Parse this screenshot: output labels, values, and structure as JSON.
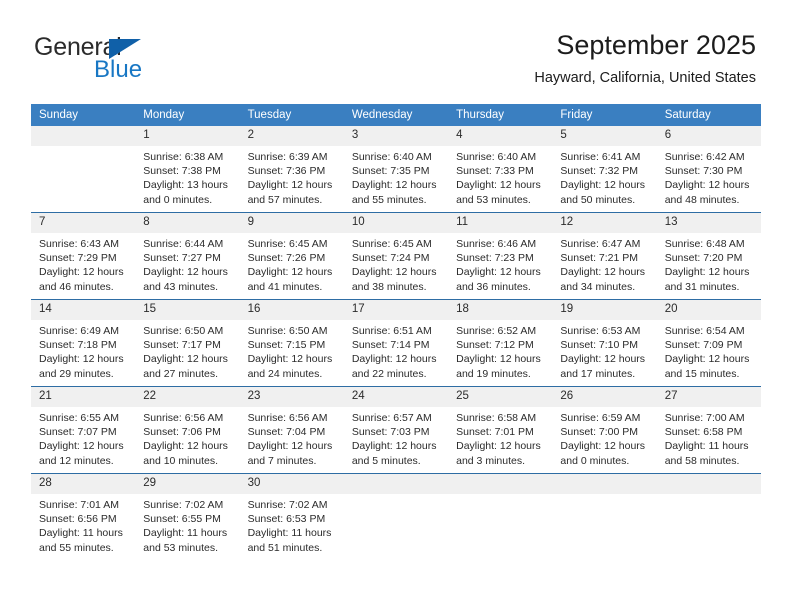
{
  "logo": {
    "word1": "General",
    "word2": "Blue",
    "triangle_color": "#1060a8",
    "blue_color": "#1877c4"
  },
  "header": {
    "title": "September 2025",
    "subtitle": "Hayward, California, United States",
    "header_bg": "#3a7fc1",
    "row_divider_color": "#2e6da4",
    "daynum_band_color": "#f0f0f0"
  },
  "weekday_headers": [
    "Sunday",
    "Monday",
    "Tuesday",
    "Wednesday",
    "Thursday",
    "Friday",
    "Saturday"
  ],
  "weeks": [
    [
      {
        "day": "",
        "sunrise": "",
        "sunset": "",
        "daylight1": "",
        "daylight2": ""
      },
      {
        "day": "1",
        "sunrise": "Sunrise: 6:38 AM",
        "sunset": "Sunset: 7:38 PM",
        "daylight1": "Daylight: 13 hours",
        "daylight2": "and 0 minutes."
      },
      {
        "day": "2",
        "sunrise": "Sunrise: 6:39 AM",
        "sunset": "Sunset: 7:36 PM",
        "daylight1": "Daylight: 12 hours",
        "daylight2": "and 57 minutes."
      },
      {
        "day": "3",
        "sunrise": "Sunrise: 6:40 AM",
        "sunset": "Sunset: 7:35 PM",
        "daylight1": "Daylight: 12 hours",
        "daylight2": "and 55 minutes."
      },
      {
        "day": "4",
        "sunrise": "Sunrise: 6:40 AM",
        "sunset": "Sunset: 7:33 PM",
        "daylight1": "Daylight: 12 hours",
        "daylight2": "and 53 minutes."
      },
      {
        "day": "5",
        "sunrise": "Sunrise: 6:41 AM",
        "sunset": "Sunset: 7:32 PM",
        "daylight1": "Daylight: 12 hours",
        "daylight2": "and 50 minutes."
      },
      {
        "day": "6",
        "sunrise": "Sunrise: 6:42 AM",
        "sunset": "Sunset: 7:30 PM",
        "daylight1": "Daylight: 12 hours",
        "daylight2": "and 48 minutes."
      }
    ],
    [
      {
        "day": "7",
        "sunrise": "Sunrise: 6:43 AM",
        "sunset": "Sunset: 7:29 PM",
        "daylight1": "Daylight: 12 hours",
        "daylight2": "and 46 minutes."
      },
      {
        "day": "8",
        "sunrise": "Sunrise: 6:44 AM",
        "sunset": "Sunset: 7:27 PM",
        "daylight1": "Daylight: 12 hours",
        "daylight2": "and 43 minutes."
      },
      {
        "day": "9",
        "sunrise": "Sunrise: 6:45 AM",
        "sunset": "Sunset: 7:26 PM",
        "daylight1": "Daylight: 12 hours",
        "daylight2": "and 41 minutes."
      },
      {
        "day": "10",
        "sunrise": "Sunrise: 6:45 AM",
        "sunset": "Sunset: 7:24 PM",
        "daylight1": "Daylight: 12 hours",
        "daylight2": "and 38 minutes."
      },
      {
        "day": "11",
        "sunrise": "Sunrise: 6:46 AM",
        "sunset": "Sunset: 7:23 PM",
        "daylight1": "Daylight: 12 hours",
        "daylight2": "and 36 minutes."
      },
      {
        "day": "12",
        "sunrise": "Sunrise: 6:47 AM",
        "sunset": "Sunset: 7:21 PM",
        "daylight1": "Daylight: 12 hours",
        "daylight2": "and 34 minutes."
      },
      {
        "day": "13",
        "sunrise": "Sunrise: 6:48 AM",
        "sunset": "Sunset: 7:20 PM",
        "daylight1": "Daylight: 12 hours",
        "daylight2": "and 31 minutes."
      }
    ],
    [
      {
        "day": "14",
        "sunrise": "Sunrise: 6:49 AM",
        "sunset": "Sunset: 7:18 PM",
        "daylight1": "Daylight: 12 hours",
        "daylight2": "and 29 minutes."
      },
      {
        "day": "15",
        "sunrise": "Sunrise: 6:50 AM",
        "sunset": "Sunset: 7:17 PM",
        "daylight1": "Daylight: 12 hours",
        "daylight2": "and 27 minutes."
      },
      {
        "day": "16",
        "sunrise": "Sunrise: 6:50 AM",
        "sunset": "Sunset: 7:15 PM",
        "daylight1": "Daylight: 12 hours",
        "daylight2": "and 24 minutes."
      },
      {
        "day": "17",
        "sunrise": "Sunrise: 6:51 AM",
        "sunset": "Sunset: 7:14 PM",
        "daylight1": "Daylight: 12 hours",
        "daylight2": "and 22 minutes."
      },
      {
        "day": "18",
        "sunrise": "Sunrise: 6:52 AM",
        "sunset": "Sunset: 7:12 PM",
        "daylight1": "Daylight: 12 hours",
        "daylight2": "and 19 minutes."
      },
      {
        "day": "19",
        "sunrise": "Sunrise: 6:53 AM",
        "sunset": "Sunset: 7:10 PM",
        "daylight1": "Daylight: 12 hours",
        "daylight2": "and 17 minutes."
      },
      {
        "day": "20",
        "sunrise": "Sunrise: 6:54 AM",
        "sunset": "Sunset: 7:09 PM",
        "daylight1": "Daylight: 12 hours",
        "daylight2": "and 15 minutes."
      }
    ],
    [
      {
        "day": "21",
        "sunrise": "Sunrise: 6:55 AM",
        "sunset": "Sunset: 7:07 PM",
        "daylight1": "Daylight: 12 hours",
        "daylight2": "and 12 minutes."
      },
      {
        "day": "22",
        "sunrise": "Sunrise: 6:56 AM",
        "sunset": "Sunset: 7:06 PM",
        "daylight1": "Daylight: 12 hours",
        "daylight2": "and 10 minutes."
      },
      {
        "day": "23",
        "sunrise": "Sunrise: 6:56 AM",
        "sunset": "Sunset: 7:04 PM",
        "daylight1": "Daylight: 12 hours",
        "daylight2": "and 7 minutes."
      },
      {
        "day": "24",
        "sunrise": "Sunrise: 6:57 AM",
        "sunset": "Sunset: 7:03 PM",
        "daylight1": "Daylight: 12 hours",
        "daylight2": "and 5 minutes."
      },
      {
        "day": "25",
        "sunrise": "Sunrise: 6:58 AM",
        "sunset": "Sunset: 7:01 PM",
        "daylight1": "Daylight: 12 hours",
        "daylight2": "and 3 minutes."
      },
      {
        "day": "26",
        "sunrise": "Sunrise: 6:59 AM",
        "sunset": "Sunset: 7:00 PM",
        "daylight1": "Daylight: 12 hours",
        "daylight2": "and 0 minutes."
      },
      {
        "day": "27",
        "sunrise": "Sunrise: 7:00 AM",
        "sunset": "Sunset: 6:58 PM",
        "daylight1": "Daylight: 11 hours",
        "daylight2": "and 58 minutes."
      }
    ],
    [
      {
        "day": "28",
        "sunrise": "Sunrise: 7:01 AM",
        "sunset": "Sunset: 6:56 PM",
        "daylight1": "Daylight: 11 hours",
        "daylight2": "and 55 minutes."
      },
      {
        "day": "29",
        "sunrise": "Sunrise: 7:02 AM",
        "sunset": "Sunset: 6:55 PM",
        "daylight1": "Daylight: 11 hours",
        "daylight2": "and 53 minutes."
      },
      {
        "day": "30",
        "sunrise": "Sunrise: 7:02 AM",
        "sunset": "Sunset: 6:53 PM",
        "daylight1": "Daylight: 11 hours",
        "daylight2": "and 51 minutes."
      },
      {
        "day": "",
        "sunrise": "",
        "sunset": "",
        "daylight1": "",
        "daylight2": ""
      },
      {
        "day": "",
        "sunrise": "",
        "sunset": "",
        "daylight1": "",
        "daylight2": ""
      },
      {
        "day": "",
        "sunrise": "",
        "sunset": "",
        "daylight1": "",
        "daylight2": ""
      },
      {
        "day": "",
        "sunrise": "",
        "sunset": "",
        "daylight1": "",
        "daylight2": ""
      }
    ]
  ]
}
